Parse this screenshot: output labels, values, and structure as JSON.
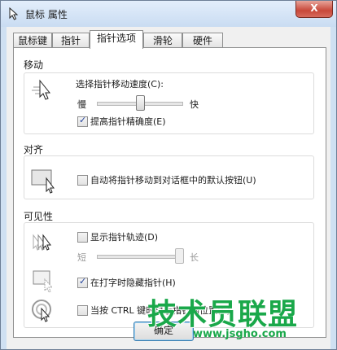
{
  "window": {
    "title": "鼠标 属性",
    "close_label": "X"
  },
  "tabs": [
    {
      "label": "鼠标键",
      "active": false
    },
    {
      "label": "指针",
      "active": false
    },
    {
      "label": "指针选项",
      "active": true
    },
    {
      "label": "滑轮",
      "active": false
    },
    {
      "label": "硬件",
      "active": false
    }
  ],
  "motion": {
    "group_label": "移动",
    "speed_label": "选择指针移动速度(C):",
    "slow_label": "慢",
    "fast_label": "快",
    "speed_value_fraction": 0.5,
    "precision_label": "提高指针精确度(E)",
    "precision_checked": true,
    "icon": "pointer-speed-icon"
  },
  "snap": {
    "group_label": "对齐",
    "label": "自动将指针移动到对话框中的默认按钮(U)",
    "checked": false,
    "icon": "snap-to-button-icon"
  },
  "visibility": {
    "group_label": "可见性",
    "trails_label": "显示指针轨迹(D)",
    "trails_checked": false,
    "short_label": "短",
    "long_label": "长",
    "trails_value_fraction": 1.0,
    "hide_label": "在打字时隐藏指针(H)",
    "hide_checked": true,
    "ctrl_label": "当按 CTRL 键时显示指针的位置(S)",
    "ctrl_checked": false,
    "icons": [
      "pointer-trails-icon",
      "hide-while-typing-icon",
      "ctrl-locate-icon"
    ]
  },
  "buttons": {
    "ok_label": "确定"
  },
  "watermark": {
    "main": "技术员联盟",
    "url": "www.jsgho.com"
  },
  "colors": {
    "accent": "#1aa84a",
    "close": "#c8483a",
    "title_bar": "#c9dcf2"
  }
}
